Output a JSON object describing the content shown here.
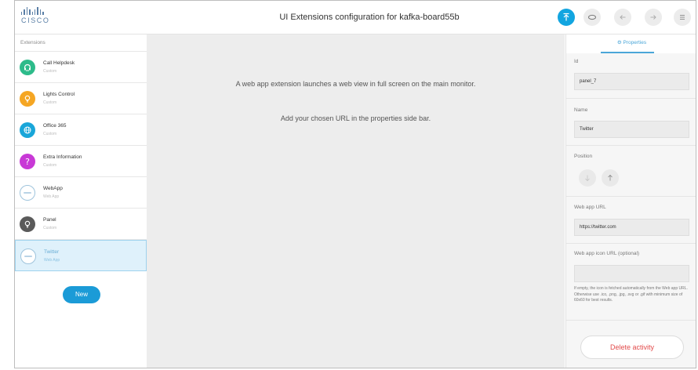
{
  "header": {
    "logo_text": "CISCO",
    "title": "UI Extensions configuration for kafka-board55b",
    "buttons": [
      {
        "icon": "upload-icon",
        "color": "#12a5e0"
      },
      {
        "icon": "preview-icon"
      },
      {
        "icon": "undo-icon"
      },
      {
        "icon": "redo-icon"
      },
      {
        "icon": "menu-icon"
      }
    ]
  },
  "sidebar": {
    "heading": "Extensions",
    "items": [
      {
        "name": "Call Helpdesk",
        "type": "Custom",
        "icon": "helpdesk-icon",
        "color": "#2dbb8a"
      },
      {
        "name": "Lights Control",
        "type": "Custom",
        "icon": "lightbulb-icon",
        "color": "#f5a623"
      },
      {
        "name": "Office 365",
        "type": "Custom",
        "icon": "globe-icon",
        "color": "#19a6d9"
      },
      {
        "name": "Extra Information",
        "type": "Custom",
        "icon": "question-icon",
        "color": "#c839d6"
      },
      {
        "name": "WebApp",
        "type": "Web App",
        "icon": "webapp-icon"
      },
      {
        "name": "Panel",
        "type": "Custom",
        "icon": "lightbulb-icon",
        "color": "#5a5a5a"
      },
      {
        "name": "Twitter",
        "type": "Web App",
        "icon": "webapp-icon",
        "selected": true
      }
    ],
    "new_label": "New"
  },
  "main": {
    "message_line1": "A web app extension launches a web view in full screen on the main monitor.",
    "message_line2": "Add your chosen URL in the properties side bar."
  },
  "properties": {
    "tab_label": "Properties",
    "id_label": "Id",
    "id_value": "panel_7",
    "name_label": "Name",
    "name_value": "Twitter",
    "position_label": "Position",
    "url_label": "Web app URL",
    "url_value": "https://twitter.com",
    "icon_url_label": "Web app icon URL (optional)",
    "icon_url_value": "",
    "icon_hint": "If empty, the icon is fetched automatically from the Web app URL. Otherwise use .ico, .png, .jpg, .svg or .gif with minimum size of 60x60 for best results.",
    "delete_label": "Delete activity"
  }
}
